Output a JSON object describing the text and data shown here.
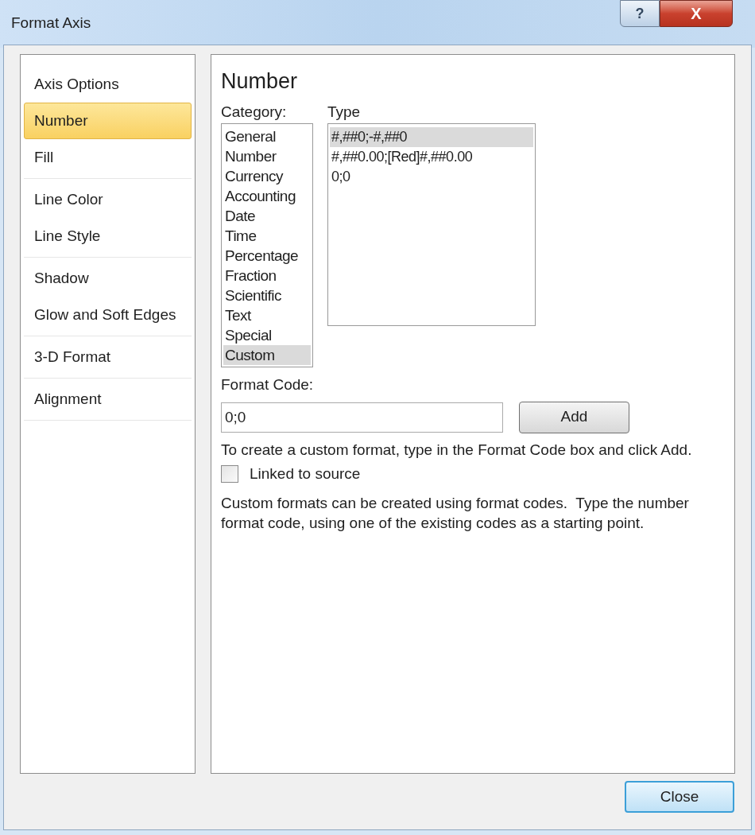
{
  "window": {
    "title": "Format Axis",
    "buttons": [
      {
        "kind": "help",
        "label": "?"
      },
      {
        "kind": "close",
        "label": "X"
      }
    ]
  },
  "sidebar": {
    "groups": [
      {
        "items": [
          {
            "label": "Axis Options",
            "selected": false
          },
          {
            "label": "Number",
            "selected": true
          },
          {
            "label": "Fill",
            "selected": false
          }
        ]
      },
      {
        "items": [
          {
            "label": "Line Color",
            "selected": false
          },
          {
            "label": "Line Style",
            "selected": false
          }
        ]
      },
      {
        "items": [
          {
            "label": "Shadow",
            "selected": false
          },
          {
            "label": "Glow and Soft Edges",
            "selected": false
          }
        ]
      },
      {
        "items": [
          {
            "label": "3-D Format",
            "selected": false
          }
        ]
      },
      {
        "items": [
          {
            "label": "Alignment",
            "selected": false
          }
        ]
      }
    ]
  },
  "panel": {
    "heading": "Number",
    "category_label": "Category:",
    "type_label": "Type",
    "categories": [
      {
        "label": "General",
        "selected": false
      },
      {
        "label": "Number",
        "selected": false
      },
      {
        "label": "Currency",
        "selected": false
      },
      {
        "label": "Accounting",
        "selected": false
      },
      {
        "label": "Date",
        "selected": false
      },
      {
        "label": "Time",
        "selected": false
      },
      {
        "label": "Percentage",
        "selected": false
      },
      {
        "label": "Fraction",
        "selected": false
      },
      {
        "label": "Scientific",
        "selected": false
      },
      {
        "label": "Text",
        "selected": false
      },
      {
        "label": "Special",
        "selected": false
      },
      {
        "label": "Custom",
        "selected": true
      }
    ],
    "types": [
      {
        "label": "#,##0;-#,##0",
        "selected": true
      },
      {
        "label": "#,##0.00;[Red]#,##0.00",
        "selected": false
      },
      {
        "label": "0;0",
        "selected": false
      }
    ],
    "format_code_label": "Format Code:",
    "format_code_value": "0;0",
    "add_button": "Add",
    "hint": "To create a custom format, type in the Format Code box and click Add.",
    "linked_to_source": {
      "label": "Linked to source",
      "checked": false
    },
    "description": "Custom formats can be created using format codes.  Type the number format code, using one of the existing codes as a starting point."
  },
  "footer": {
    "close_button": "Close"
  }
}
